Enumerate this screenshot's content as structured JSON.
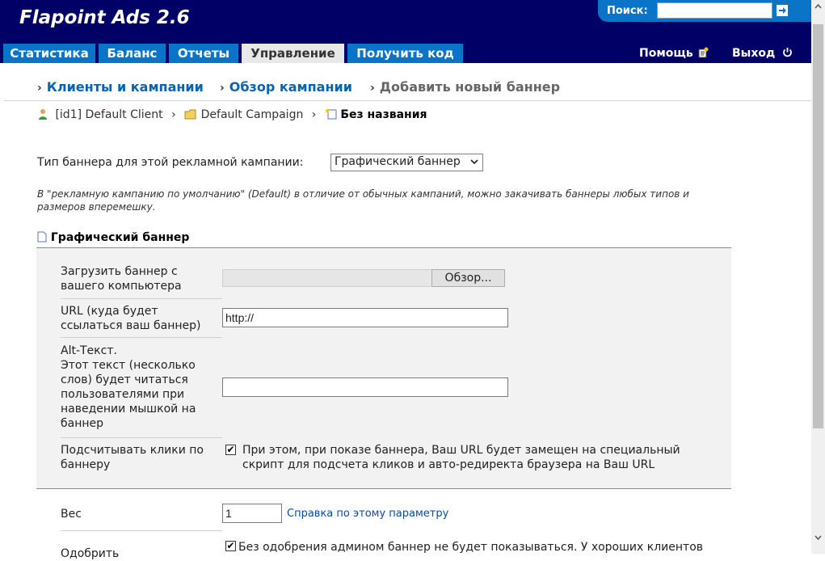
{
  "app": {
    "title": "Flapoint Ads 2.6"
  },
  "search": {
    "label": "Поиск:",
    "value": ""
  },
  "tabs": [
    {
      "label": "Статистика"
    },
    {
      "label": "Баланс"
    },
    {
      "label": "Отчеты"
    },
    {
      "label": "Управление"
    },
    {
      "label": "Получить код"
    }
  ],
  "header_links": {
    "help": "Помощь",
    "exit": "Выход"
  },
  "nav": {
    "clients": "Клиенты и кампании",
    "overview": "Обзор кампании",
    "current": "Добавить новый баннер"
  },
  "path": {
    "client": "[id1] Default Client",
    "campaign": "Default Campaign",
    "banner": "Без названия"
  },
  "banner_type": {
    "label": "Тип баннера для этой рекламной кампании:",
    "selected": "Графический баннер"
  },
  "note": "В \"рекламную кампанию по умолчанию\" (Default) в отличие от обычных кампаний, можно закачивать баннеры любых типов и размеров вперемешку.",
  "section": {
    "title": "Графический баннер"
  },
  "form": {
    "upload_label": "Загрузить баннер с вашего компьютера",
    "browse_label": "Обзор...",
    "url_label": "URL (куда будет ссылаться ваш баннер)",
    "url_value": "http://",
    "alt_label": "Alt-Текст.",
    "alt_desc": "Этот текст (несколько слов) будет читаться пользователями при наведении мышкой на баннер",
    "alt_value": "",
    "count_label": "Подсчитывать клики по баннеру",
    "count_checked": true,
    "count_desc": "При этом, при показе баннера, Ваш URL будет замещен на специальный скрипт для подсчета кликов и авто-редиректа браузера на Ваш URL",
    "weight_label": "Вес",
    "weight_value": "1",
    "weight_help": "Справка по этому параметру",
    "approve_label": "Одобрить",
    "approve_checked": true,
    "approve_desc": "Без одобрения админом баннер не будет показываться. У хороших клиентов"
  },
  "colors": {
    "header_bg": "#000066",
    "tab_bg": "#0a74c8",
    "tab_active_bg": "#e8e8e8",
    "link": "#0a63b0"
  }
}
